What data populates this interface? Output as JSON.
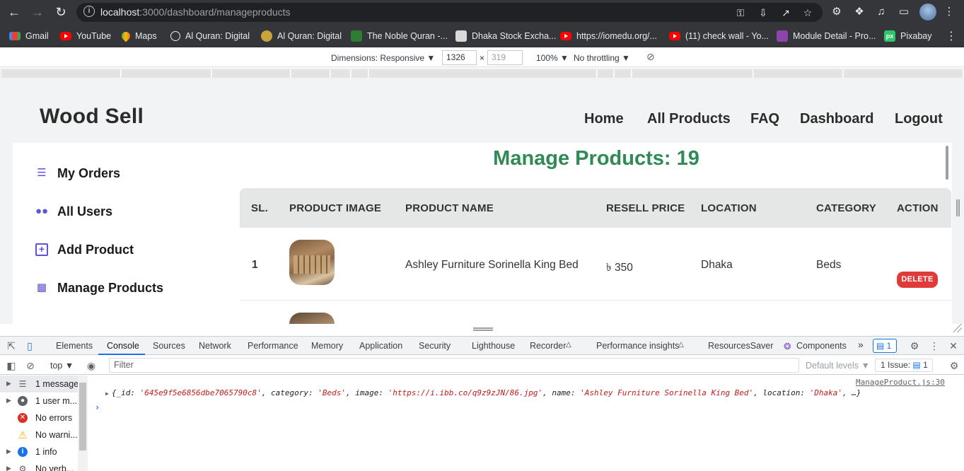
{
  "browser": {
    "url_host": "localhost",
    "url_path": ":3000/dashboard/manageproducts",
    "bookmarks": [
      {
        "label": "Gmail",
        "icon": "gmail-icon"
      },
      {
        "label": "YouTube",
        "icon": "youtube-icon"
      },
      {
        "label": "Maps",
        "icon": "maps-icon"
      },
      {
        "label": "Al Quran: Digital",
        "icon": "globe-icon"
      },
      {
        "label": "Al Quran: Digital",
        "icon": "quran-icon"
      },
      {
        "label": "The Noble Quran -...",
        "icon": "noble-quran-icon"
      },
      {
        "label": "Dhaka Stock Excha...",
        "icon": "dse-icon"
      },
      {
        "label": "https://iomedu.org/...",
        "icon": "youtube-icon"
      },
      {
        "label": "(11) check wall - Yo...",
        "icon": "youtube-icon"
      },
      {
        "label": "Module Detail - Pro...",
        "icon": "module-icon"
      },
      {
        "label": "Pixabay",
        "icon": "pixabay-icon"
      }
    ]
  },
  "device_toolbar": {
    "dimensions_label": "Dimensions: Responsive ▼",
    "width": "1326",
    "height_placeholder": "319",
    "times": "×",
    "zoom": "100% ▼",
    "throttling": "No throttling ▼"
  },
  "site": {
    "brand": "Wood Sell",
    "nav": [
      "Home",
      "All Products",
      "FAQ",
      "Dashboard",
      "Logout"
    ],
    "sidebar": [
      {
        "label": "My Orders",
        "icon": "list-check-icon"
      },
      {
        "label": "All Users",
        "icon": "users-icon"
      },
      {
        "label": "Add Product",
        "icon": "plus-square-icon"
      },
      {
        "label": "Manage Products",
        "icon": "dolly-icon"
      }
    ],
    "title": "Manage Products: 19",
    "table": {
      "headers": [
        "SL.",
        "PRODUCT IMAGE",
        "PRODUCT NAME",
        "RESELL PRICE",
        "LOCATION",
        "CATEGORY",
        "ACTION"
      ],
      "rows": [
        {
          "sl": "1",
          "name": "Ashley Furniture Sorinella King Bed",
          "price": "৳ 350",
          "location": "Dhaka",
          "category": "Beds",
          "action": "DELETE"
        }
      ]
    },
    "accent_green": "#2f8a55",
    "delete_red": "#e03b3b",
    "icon_purple": "#5a54d8"
  },
  "devtools": {
    "tabs": [
      "Elements",
      "Console",
      "Sources",
      "Network",
      "Performance",
      "Memory",
      "Application",
      "Security",
      "Lighthouse",
      "Recorder",
      "Performance insights",
      "ResourcesSaver",
      "Components"
    ],
    "active_tab": "Console",
    "message_badge": "1",
    "context": "top ▼",
    "filter_placeholder": "Filter",
    "default_levels": "Default levels ▼",
    "issues": "1 Issue:",
    "issues_count": "1",
    "sidebar": [
      {
        "label": "1 message"
      },
      {
        "label": "1 user m..."
      },
      {
        "label": "No errors"
      },
      {
        "label": "No warni..."
      },
      {
        "label": "1 info"
      },
      {
        "label": "No verb..."
      }
    ],
    "log": {
      "source": "ManageProduct.js:30",
      "text_open": "{_id: ",
      "id": "'645e9f5e6856dbe7065790c8'",
      "k_category": ", category: ",
      "category": "'Beds'",
      "k_image": ", image: ",
      "image": "'https://i.ibb.co/q9z9zJN/86.jpg'",
      "k_name": ", name: ",
      "name": "'Ashley Furniture Sorinella King Bed'",
      "k_location": ", location: ",
      "location": "'Dhaka'",
      "tail": ", …}"
    }
  }
}
